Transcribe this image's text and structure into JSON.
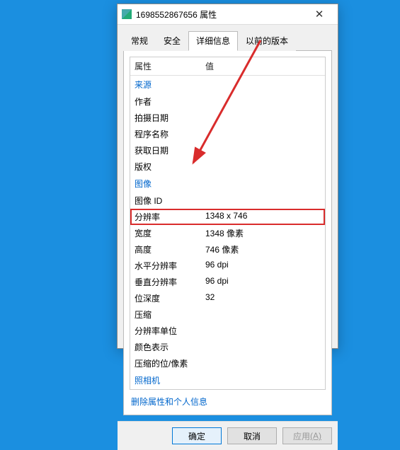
{
  "window": {
    "title": "1698552867656 属性",
    "close_glyph": "✕"
  },
  "tabs": [
    {
      "label": "常规"
    },
    {
      "label": "安全"
    },
    {
      "label": "详细信息",
      "active": true
    },
    {
      "label": "以前的版本"
    }
  ],
  "headers": {
    "property": "属性",
    "value": "值"
  },
  "sections": [
    {
      "title": "来源",
      "rows": [
        {
          "k": "作者",
          "v": ""
        },
        {
          "k": "拍摄日期",
          "v": ""
        },
        {
          "k": "程序名称",
          "v": ""
        },
        {
          "k": "获取日期",
          "v": ""
        },
        {
          "k": "版权",
          "v": ""
        }
      ]
    },
    {
      "title": "图像",
      "rows": [
        {
          "k": "图像 ID",
          "v": ""
        },
        {
          "k": "分辨率",
          "v": "1348 x 746",
          "highlight": true
        },
        {
          "k": "宽度",
          "v": "1348 像素"
        },
        {
          "k": "高度",
          "v": "746 像素"
        },
        {
          "k": "水平分辨率",
          "v": "96 dpi"
        },
        {
          "k": "垂直分辨率",
          "v": "96 dpi"
        },
        {
          "k": "位深度",
          "v": "32"
        },
        {
          "k": "压缩",
          "v": ""
        },
        {
          "k": "分辨率单位",
          "v": ""
        },
        {
          "k": "颜色表示",
          "v": ""
        },
        {
          "k": "压缩的位/像素",
          "v": ""
        }
      ]
    },
    {
      "title": "照相机",
      "rows": []
    }
  ],
  "remove_link": "删除属性和个人信息",
  "buttons": {
    "ok": "确定",
    "cancel": "取消",
    "apply": "应用",
    "apply_mnemonic": "(A)"
  }
}
